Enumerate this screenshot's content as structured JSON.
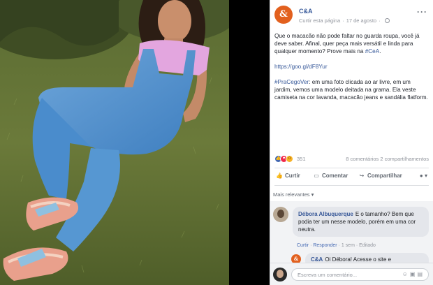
{
  "post": {
    "page_name": "C&A",
    "avatar_letter": "&",
    "meta_like": "Curtir esta página",
    "meta_date": "17 de agosto",
    "text_1": "Que o macacão não pode faltar no guarda roupa, você já deve saber. Afinal, quer peça mais versátil e linda para qualquer momento? Prove mais na ",
    "hashtag_cea": "#CeA",
    "text_1_end": ".",
    "short_link": "https://goo.gl/dF8Yur",
    "hashtag_pracegover": "#PraCegoVer",
    "description": ": em uma foto clicada ao ar livre, em um jardim, vemos uma modelo deitada na grama. Ela veste camiseta na cor lavanda, macacão jeans e sandália flatform."
  },
  "reactions": {
    "count": "351",
    "comments_shares": "8 comentários  2 compartilhamentos"
  },
  "actions": {
    "like": "Curtir",
    "comment": "Comentar",
    "share": "Compartilhar"
  },
  "sort_label": "Mais relevantes ▾",
  "comments": [
    {
      "author": "Débora Albuquerque",
      "text": "E o tamanho? Bem que podia ter um nesse modelo, porém em uma cor neutra.",
      "like_link": "Curtir",
      "reply_link": "Responder",
      "time": "1 sem",
      "edited": "Editado"
    }
  ],
  "reply": {
    "author": "C&A",
    "text": "Oi Débora! Acesse o site e"
  },
  "composer": {
    "placeholder": "Escreva um comentário..."
  },
  "colors": {
    "brand": "#e2601e",
    "link": "#365899",
    "panel_bg": "#ffffff"
  }
}
